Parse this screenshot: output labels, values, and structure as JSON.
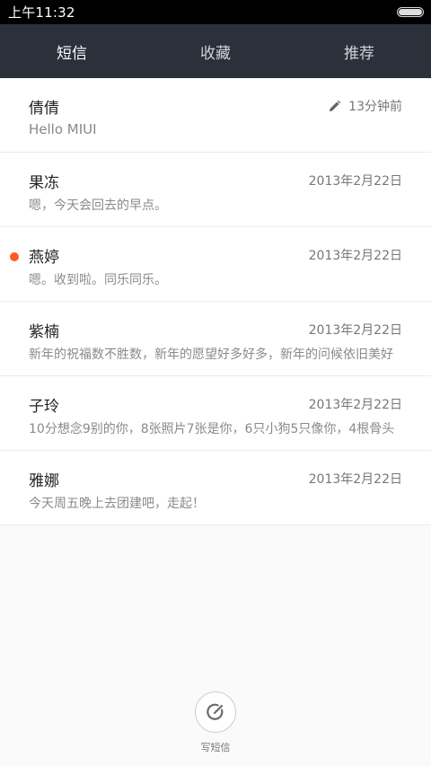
{
  "status_bar": {
    "time": "上午11:32"
  },
  "tabs": [
    {
      "label": "短信",
      "active": true
    },
    {
      "label": "收藏",
      "active": false
    },
    {
      "label": "推荐",
      "active": false
    }
  ],
  "threads": [
    {
      "contact": "倩倩",
      "snippet": "Hello MIUI",
      "time": "13分钟前",
      "draft": true,
      "unread": false
    },
    {
      "contact": "果冻",
      "snippet": "嗯，今天会回去的早点。",
      "time": "2013年2月22日",
      "draft": false,
      "unread": false
    },
    {
      "contact": "燕婷",
      "snippet": "嗯。收到啦。同乐同乐。",
      "time": "2013年2月22日",
      "draft": false,
      "unread": true
    },
    {
      "contact": "紫楠",
      "snippet": "新年的祝福数不胜数，新年的愿望好多好多，新年的问候依旧美好",
      "time": "2013年2月22日",
      "draft": false,
      "unread": false
    },
    {
      "contact": "子玲",
      "snippet": "10分想念9别的你，8张照片7张是你，6只小狗5只像你，4根骨头",
      "time": "2013年2月22日",
      "draft": false,
      "unread": false
    },
    {
      "contact": "雅娜",
      "snippet": "今天周五晚上去团建吧，走起！",
      "time": "2013年2月22日",
      "draft": false,
      "unread": false
    }
  ],
  "compose": {
    "label": "写短信",
    "icon": "compose-icon"
  },
  "colors": {
    "tab_bar": "#2a313a",
    "unread": "#ff5a1f"
  }
}
